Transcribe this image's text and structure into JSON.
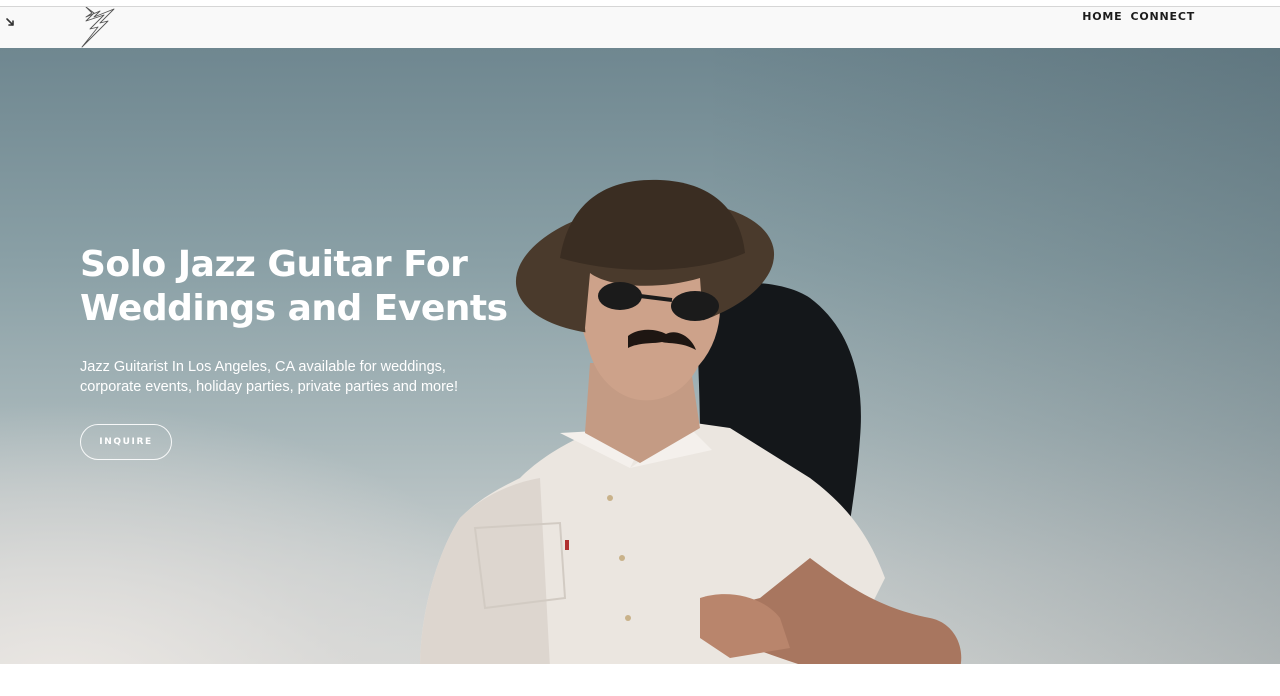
{
  "header": {
    "logo_icon": "lightning-bolt-logo-icon",
    "nav": [
      {
        "label": "HOME"
      },
      {
        "label": "CONNECT"
      }
    ]
  },
  "hero": {
    "title": "Solo Jazz Guitar For Weddings and Events",
    "subtitle": "Jazz Guitarist In Los Angeles, CA available for weddings, corporate events, holiday parties, private parties and more!",
    "cta_label": "INQUIRE",
    "image_subject": "musician-with-guitar-case-photo"
  },
  "colors": {
    "sky_top": "#6f8790",
    "sky_bottom": "#d6d8d6",
    "text": "#ffffff",
    "nav_text": "#1c1c1c"
  }
}
